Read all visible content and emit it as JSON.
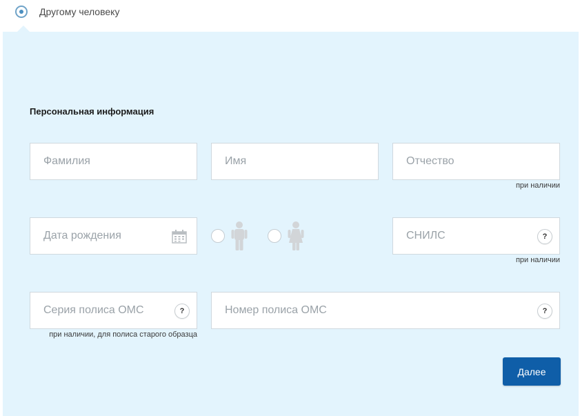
{
  "recipient": {
    "selected_option_label": "Другому человеку"
  },
  "form": {
    "section_title": "Персональная информация",
    "fields": {
      "last_name": {
        "placeholder": "Фамилия",
        "value": ""
      },
      "first_name": {
        "placeholder": "Имя",
        "value": ""
      },
      "patronymic": {
        "placeholder": "Отчество",
        "value": "",
        "hint": "при наличии"
      },
      "birth_date": {
        "placeholder": "Дата рождения",
        "value": ""
      },
      "snils": {
        "placeholder": "СНИЛС",
        "value": "",
        "hint": "при наличии"
      },
      "oms_series": {
        "placeholder": "Серия полиса ОМС",
        "value": "",
        "hint": "при наличии, для полиса старого образца"
      },
      "oms_number": {
        "placeholder": "Номер полиса ОМС",
        "value": ""
      }
    },
    "help_symbol": "?",
    "next_button_label": "Далее"
  },
  "icons": [
    "radio-selected-icon",
    "calendar-icon",
    "male-icon",
    "female-icon",
    "help-icon"
  ],
  "colors": {
    "panel_bg": "#e3f4fd",
    "button_bg": "#0f5ea8",
    "radio_accent": "#4c8fc0",
    "figure_gray": "#d2d5d8"
  }
}
